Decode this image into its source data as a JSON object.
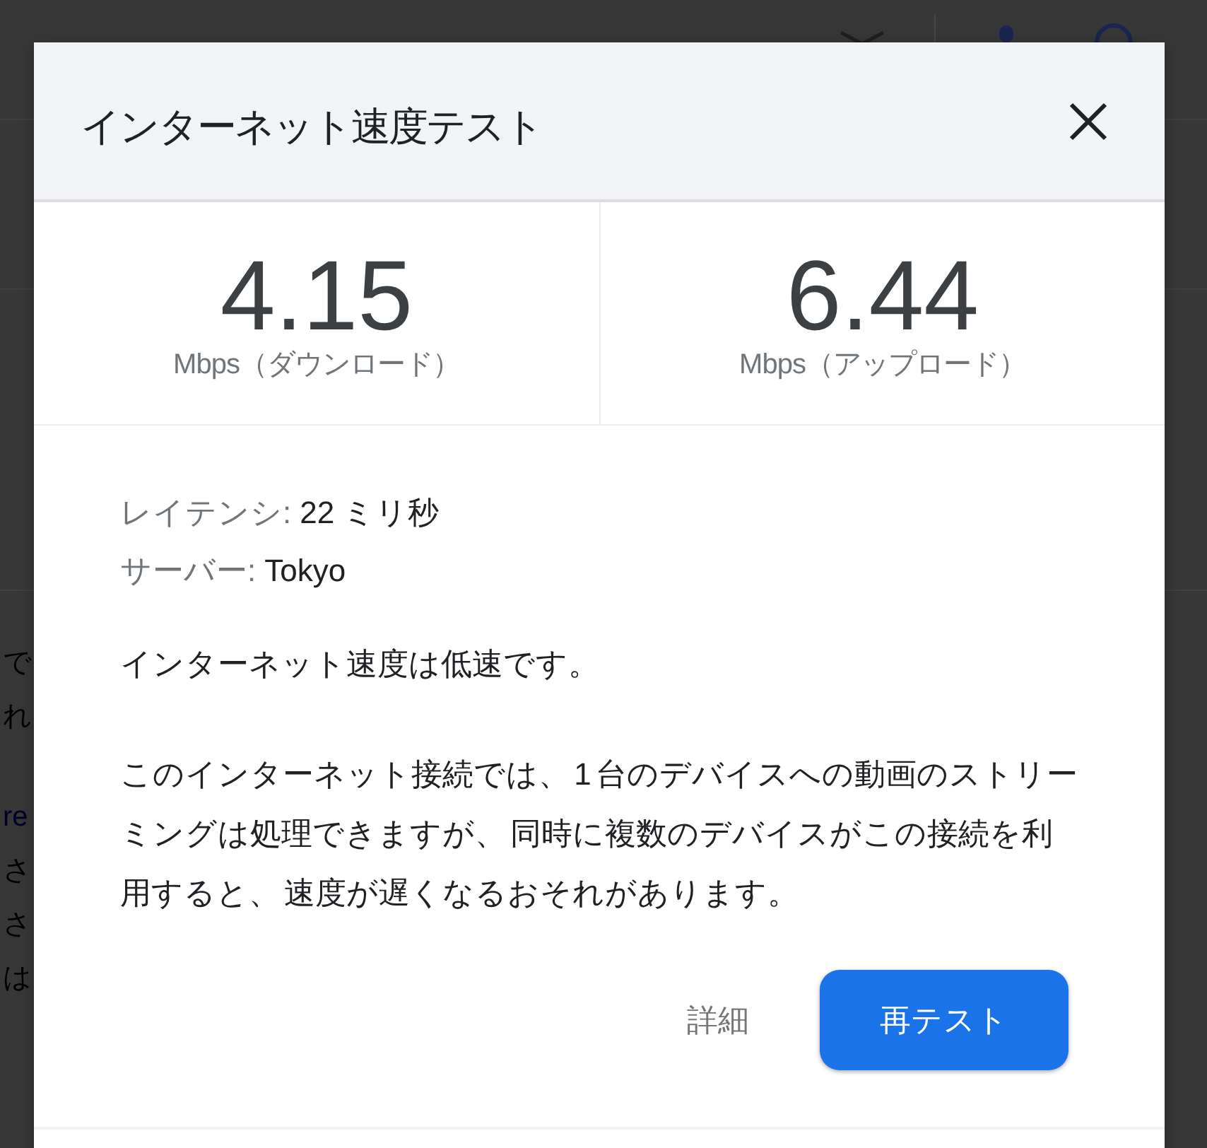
{
  "background_page": {
    "paragraphs": [
      {
        "lines": [
          {
            "text": "で",
            "kind": "text"
          },
          {
            "text": "れ",
            "kind": "text"
          }
        ]
      },
      {
        "lines": [
          {
            "text": "re",
            "kind": "link"
          },
          {
            "text": "さ",
            "kind": "text"
          },
          {
            "text": "さ",
            "kind": "text"
          },
          {
            "text": "は",
            "kind": "text"
          }
        ]
      }
    ]
  },
  "dialog": {
    "title": "インターネット速度テスト",
    "results": [
      {
        "value": "4.15",
        "unit": "Mbps（ダウンロード）"
      },
      {
        "value": "6.44",
        "unit": "Mbps（アップロード）"
      }
    ],
    "details": [
      {
        "label": "レイテンシ:",
        "value": "22 ミリ秒"
      },
      {
        "label": "サーバー:",
        "value": "Tokyo"
      }
    ],
    "summary": "インターネット速度は低速です。",
    "description": "このインターネット接続では、 1 台のデバイスへの動画のストリーミングは処理できますが、 同時に複数のデバイスがこの接続を利用すると、 速度が遅くなるおそれがあります。",
    "buttons": [
      {
        "label": "詳細",
        "kind": "text"
      },
      {
        "label": "再テスト",
        "kind": "filled"
      }
    ]
  }
}
